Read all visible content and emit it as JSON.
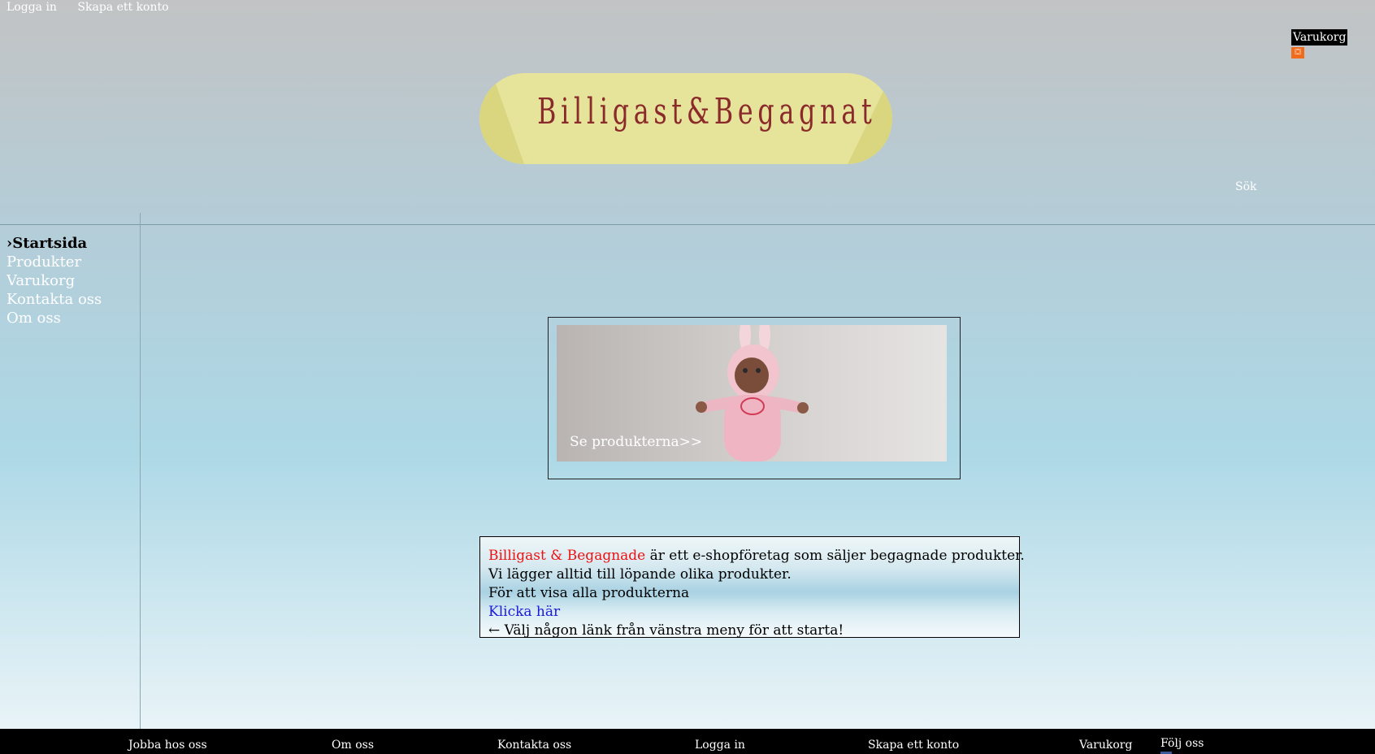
{
  "top_nav": {
    "login": "Logga in",
    "create_account": "Skapa ett konto"
  },
  "cart": {
    "label": "Varukorg",
    "icon": "shopping-cart-icon"
  },
  "logo": {
    "text": "Billigast&Begagnat"
  },
  "search": {
    "label": "Sök"
  },
  "sidebar": {
    "items": [
      {
        "label": "›Startsida",
        "active": true
      },
      {
        "label": "Produkter"
      },
      {
        "label": "Varukorg"
      },
      {
        "label": "Kontakta oss"
      },
      {
        "label": "Om oss"
      }
    ]
  },
  "hero": {
    "caption": "Se produkterna>>"
  },
  "info": {
    "brand": "Billigast & Begagnade",
    "line1_rest": " är ett e-shopföretag som säljer begagnade produkter.",
    "line2": "Vi lägger alltid till löpande olika produkter.",
    "line3": "För att visa alla produkterna",
    "link": "Klicka här",
    "line5": "← Välj någon länk från vänstra meny för att starta!"
  },
  "footer": {
    "jobs": "Jobba hos oss",
    "about": "Om oss",
    "contact": "Kontakta oss",
    "login": "Logga in",
    "create_account": "Skapa ett konto",
    "cart": "Varukorg",
    "follow": "Följ oss"
  },
  "colors": {
    "brand_red": "#ee1111",
    "link_blue": "#1a1adb",
    "logo_bg": "#e6e39b",
    "logo_text": "#8b2a2a",
    "cart_orange": "#f26b1d"
  }
}
